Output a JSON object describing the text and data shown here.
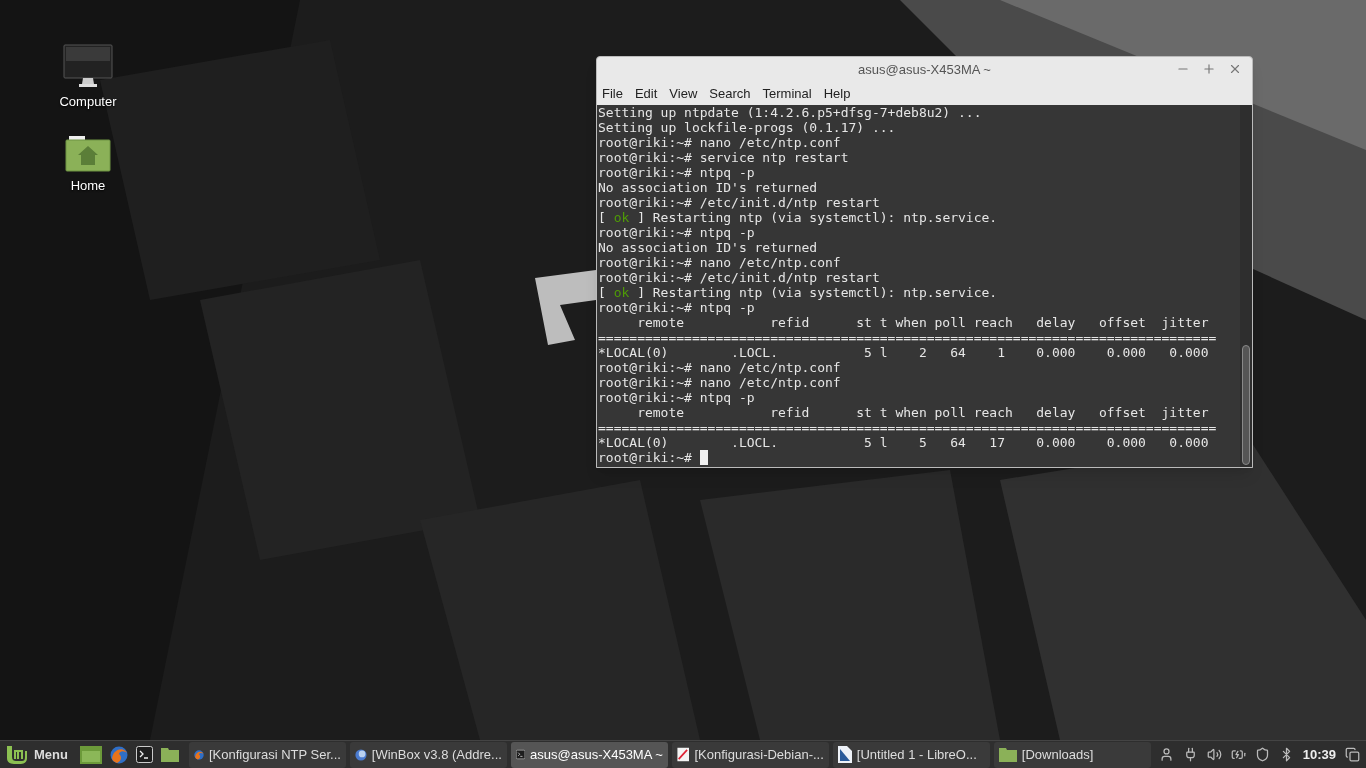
{
  "desktop_icons": [
    {
      "kind": "computer",
      "label": "Computer"
    },
    {
      "kind": "home",
      "label": "Home"
    }
  ],
  "terminal": {
    "title": "asus@asus-X453MA ~",
    "menu": [
      "File",
      "Edit",
      "View",
      "Search",
      "Terminal",
      "Help"
    ],
    "lines": [
      {
        "segments": [
          {
            "text": "Setting up ntpdate (1:4.2.6.p5+dfsg-7+deb8u2) ..."
          }
        ]
      },
      {
        "segments": [
          {
            "text": "Setting up lockfile-progs (0.1.17) ..."
          }
        ]
      },
      {
        "segments": [
          {
            "text": "root@riki:~# nano /etc/ntp.conf"
          }
        ]
      },
      {
        "segments": [
          {
            "text": "root@riki:~# service ntp restart"
          }
        ]
      },
      {
        "segments": [
          {
            "text": "root@riki:~# ntpq -p"
          }
        ]
      },
      {
        "segments": [
          {
            "text": "No association ID's returned"
          }
        ]
      },
      {
        "segments": [
          {
            "text": "root@riki:~# /etc/init.d/ntp restart"
          }
        ]
      },
      {
        "segments": [
          {
            "text": "[ "
          },
          {
            "text": "ok",
            "color": "#4e9a06"
          },
          {
            "text": " ] Restarting ntp (via systemctl): ntp.service."
          }
        ]
      },
      {
        "segments": [
          {
            "text": "root@riki:~# ntpq -p"
          }
        ]
      },
      {
        "segments": [
          {
            "text": "No association ID's returned"
          }
        ]
      },
      {
        "segments": [
          {
            "text": "root@riki:~# nano /etc/ntp.conf"
          }
        ]
      },
      {
        "segments": [
          {
            "text": "root@riki:~# /etc/init.d/ntp restart"
          }
        ]
      },
      {
        "segments": [
          {
            "text": "[ "
          },
          {
            "text": "ok",
            "color": "#4e9a06"
          },
          {
            "text": " ] Restarting ntp (via systemctl): ntp.service."
          }
        ]
      },
      {
        "segments": [
          {
            "text": "root@riki:~# ntpq -p"
          }
        ]
      },
      {
        "segments": [
          {
            "text": "     remote           refid      st t when poll reach   delay   offset  jitter"
          }
        ]
      },
      {
        "segments": [
          {
            "text": "==============================================================================="
          }
        ]
      },
      {
        "segments": [
          {
            "text": "*LOCAL(0)        .LOCL.           5 l    2   64    1    0.000    0.000   0.000"
          }
        ]
      },
      {
        "segments": [
          {
            "text": "root@riki:~# nano /etc/ntp.conf"
          }
        ]
      },
      {
        "segments": [
          {
            "text": "root@riki:~# nano /etc/ntp.conf"
          }
        ]
      },
      {
        "segments": [
          {
            "text": "root@riki:~# ntpq -p"
          }
        ]
      },
      {
        "segments": [
          {
            "text": "     remote           refid      st t when poll reach   delay   offset  jitter"
          }
        ]
      },
      {
        "segments": [
          {
            "text": "==============================================================================="
          }
        ]
      },
      {
        "segments": [
          {
            "text": "*LOCAL(0)        .LOCL.           5 l    5   64   17    0.000    0.000   0.000"
          }
        ]
      }
    ],
    "prompt": "root@riki:~# "
  },
  "taskbar": {
    "menu_label": "Menu",
    "launchers": [
      {
        "kind": "drawer"
      },
      {
        "kind": "browser"
      },
      {
        "kind": "terminal"
      },
      {
        "kind": "folder"
      }
    ],
    "windows": [
      {
        "kind": "browser",
        "title": "[Konfigurasi NTP Ser...",
        "selected": false
      },
      {
        "kind": "globe",
        "title": "[WinBox v3.8 (Addre...",
        "selected": false
      },
      {
        "kind": "terminal",
        "title": "asus@asus-X453MA ~",
        "selected": true
      },
      {
        "kind": "pdf",
        "title": "[Konfigurasi-Debian-...",
        "selected": false
      },
      {
        "kind": "document",
        "title": "[Untitled 1 - LibreO...",
        "selected": false
      },
      {
        "kind": "folder",
        "title": "[Downloads]",
        "selected": false
      }
    ],
    "clock": "10:39"
  }
}
